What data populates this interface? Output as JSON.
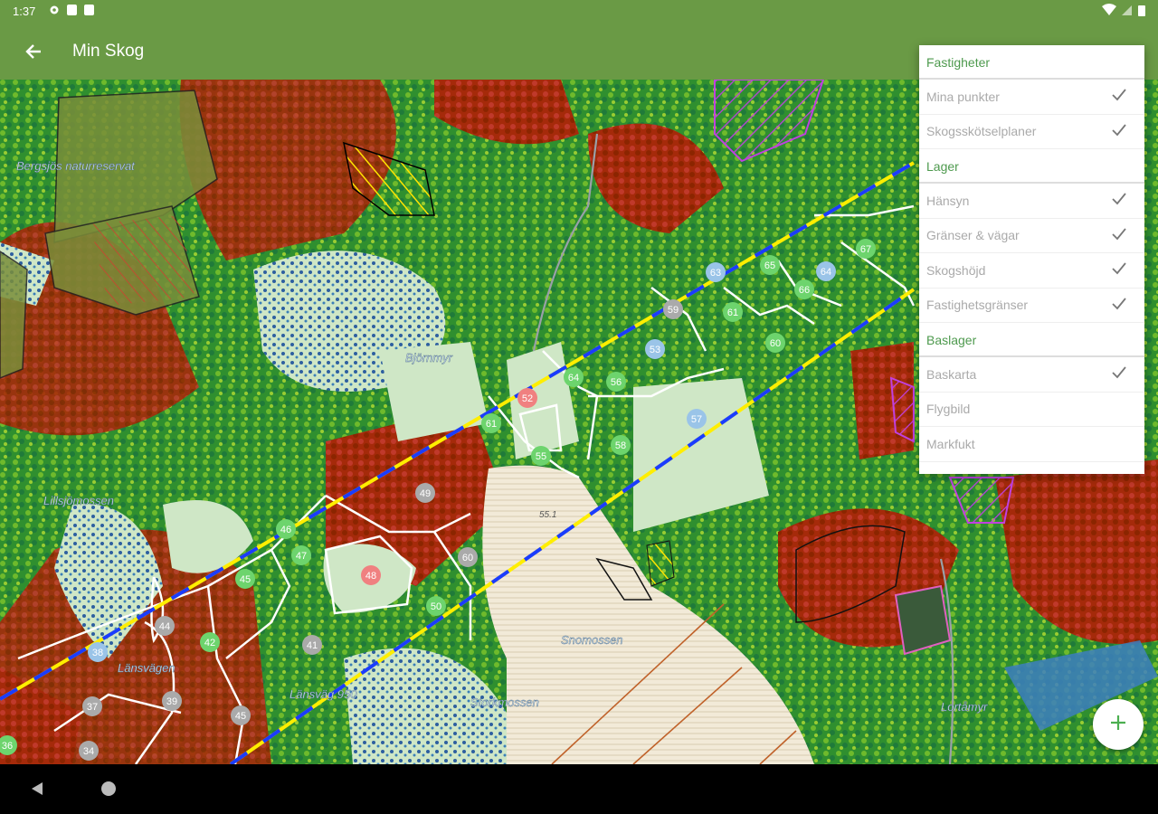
{
  "status_bar": {
    "time": "1:37"
  },
  "app_bar": {
    "title": "Min Skog",
    "back_icon": "arrow-left-icon"
  },
  "menu": {
    "sections": [
      {
        "title": "Fastigheter",
        "items": [
          {
            "label": "Mina punkter",
            "checked": true
          },
          {
            "label": "Skogsskötselplaner",
            "checked": true
          }
        ]
      },
      {
        "title": "Lager",
        "items": [
          {
            "label": "Hänsyn",
            "checked": true
          },
          {
            "label": "Gränser & vägar",
            "checked": true
          },
          {
            "label": "Skogshöjd",
            "checked": true
          },
          {
            "label": "Fastighetsgränser",
            "checked": true
          }
        ]
      },
      {
        "title": "Baslager",
        "items": [
          {
            "label": "Baskarta",
            "checked": true
          },
          {
            "label": "Flygbild",
            "checked": false
          },
          {
            "label": "Markfukt",
            "checked": false
          }
        ]
      }
    ]
  },
  "map": {
    "place_names": [
      "Bergsjös naturreservat",
      "Björnmyr",
      "Snomossen",
      "Storkmossen",
      "Lillsjömossen",
      "Länsväg 950",
      "Länsvägen",
      "Lortåmyr",
      "55.1"
    ],
    "stand_numbers": [
      "67",
      "63",
      "64",
      "65",
      "66",
      "68",
      "59",
      "61",
      "60",
      "53",
      "57",
      "58",
      "64",
      "52",
      "61",
      "55",
      "56",
      "49",
      "46",
      "47",
      "45",
      "48",
      "50",
      "44",
      "42",
      "39",
      "41",
      "37",
      "38",
      "45",
      "36",
      "34",
      "60"
    ]
  },
  "fab": {
    "icon": "plus-icon"
  },
  "nav_bar": {
    "back_icon": "triangle-back-icon",
    "home_icon": "circle-home-icon"
  },
  "colors": {
    "app_bar": "#6a9a45",
    "section_title": "#4e9a4e",
    "line_yellow": "#ffee00",
    "line_blue": "#1a3cff"
  }
}
